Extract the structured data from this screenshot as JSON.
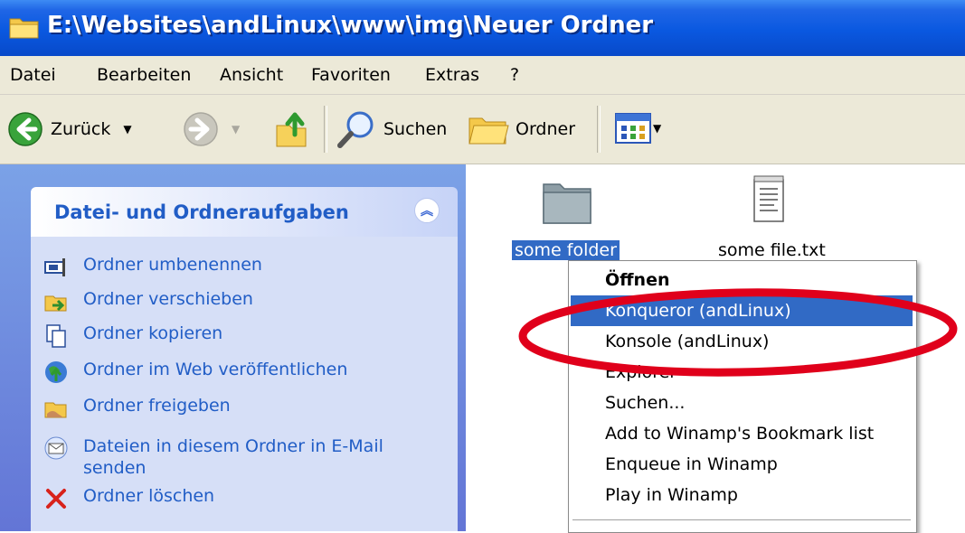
{
  "window": {
    "title": "E:\\Websites\\andLinux\\www\\img\\Neuer Ordner"
  },
  "menu": [
    "Datei",
    "Bearbeiten",
    "Ansicht",
    "Favoriten",
    "Extras",
    "?"
  ],
  "toolbar": {
    "back_label": "Zurück",
    "search_label": "Suchen",
    "folders_label": "Ordner"
  },
  "task_panel": {
    "title": "Datei- und Ordneraufgaben",
    "tasks": [
      {
        "label": "Ordner umbenennen",
        "icon": "rename-icon"
      },
      {
        "label": "Ordner verschieben",
        "icon": "move-icon"
      },
      {
        "label": "Ordner kopieren",
        "icon": "copy-icon"
      },
      {
        "label": "Ordner im Web veröffentlichen",
        "icon": "publish-web-icon"
      },
      {
        "label": "Ordner freigeben",
        "icon": "share-icon"
      },
      {
        "label": "Dateien in diesem Ordner in E-Mail senden",
        "icon": "email-icon"
      },
      {
        "label": "Ordner löschen",
        "icon": "delete-icon"
      }
    ]
  },
  "files": [
    {
      "name": "some folder",
      "icon": "folder-icon",
      "selected": true
    },
    {
      "name": "some file.txt",
      "icon": "text-file-icon",
      "selected": false
    }
  ],
  "context_menu": {
    "items": [
      {
        "label": "Öffnen",
        "bold": true
      },
      {
        "label": "Konqueror (andLinux)",
        "highlighted": true
      },
      {
        "label": "Konsole (andLinux)"
      },
      {
        "label": "Explorer"
      },
      {
        "label": "Suchen..."
      },
      {
        "label": "Add to Winamp's Bookmark list"
      },
      {
        "label": "Enqueue in Winamp"
      },
      {
        "label": "Play in Winamp"
      }
    ]
  },
  "colors": {
    "title_bar": "#0a58e0",
    "selection": "#316ac5",
    "task_link": "#215dc6",
    "annotation": "#e0001b"
  }
}
